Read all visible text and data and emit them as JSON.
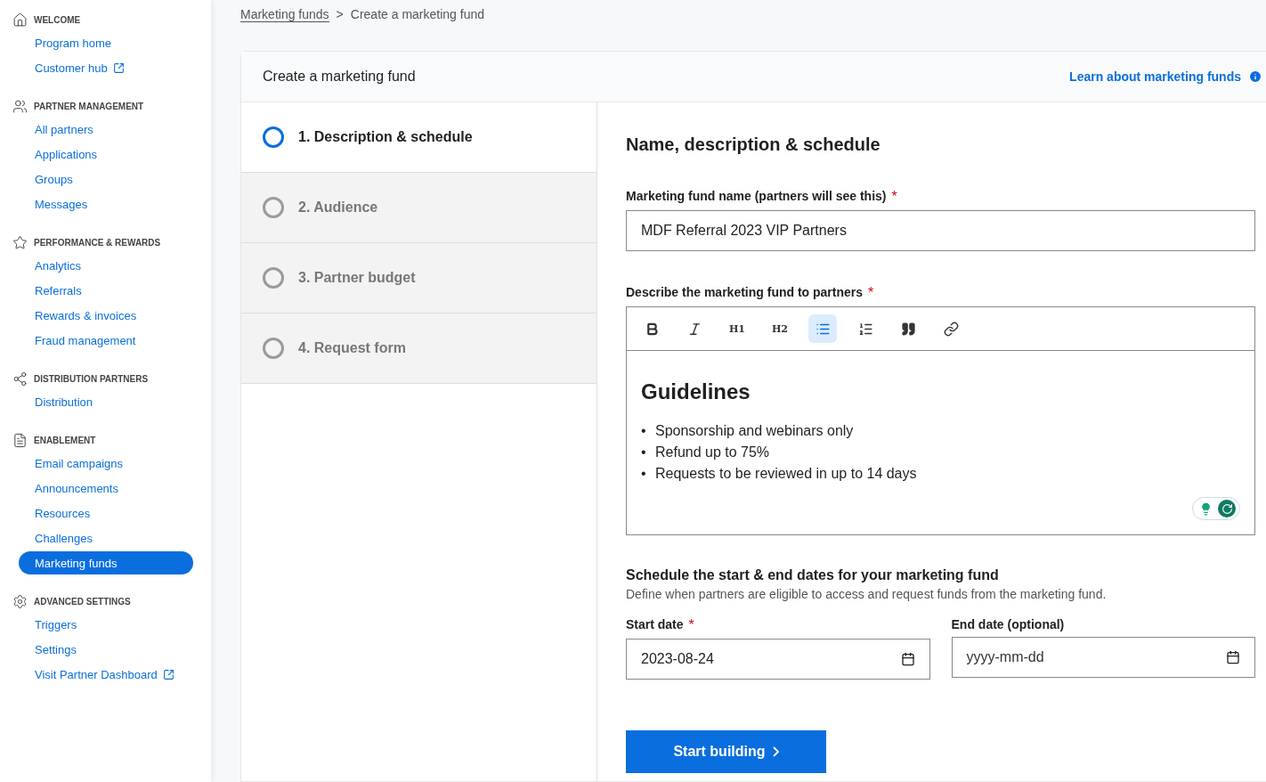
{
  "sidebar": {
    "sections": [
      {
        "title": "WELCOME",
        "items": [
          {
            "label": "Program home",
            "external": false,
            "selected": false
          },
          {
            "label": "Customer hub",
            "external": true,
            "selected": false
          }
        ]
      },
      {
        "title": "PARTNER MANAGEMENT",
        "items": [
          {
            "label": "All partners",
            "external": false,
            "selected": false
          },
          {
            "label": "Applications",
            "external": false,
            "selected": false
          },
          {
            "label": "Groups",
            "external": false,
            "selected": false
          },
          {
            "label": "Messages",
            "external": false,
            "selected": false
          }
        ]
      },
      {
        "title": "PERFORMANCE & REWARDS",
        "items": [
          {
            "label": "Analytics",
            "external": false,
            "selected": false
          },
          {
            "label": "Referrals",
            "external": false,
            "selected": false
          },
          {
            "label": "Rewards & invoices",
            "external": false,
            "selected": false
          },
          {
            "label": "Fraud management",
            "external": false,
            "selected": false
          }
        ]
      },
      {
        "title": "DISTRIBUTION PARTNERS",
        "items": [
          {
            "label": "Distribution",
            "external": false,
            "selected": false
          }
        ]
      },
      {
        "title": "ENABLEMENT",
        "items": [
          {
            "label": "Email campaigns",
            "external": false,
            "selected": false
          },
          {
            "label": "Announcements",
            "external": false,
            "selected": false
          },
          {
            "label": "Resources",
            "external": false,
            "selected": false
          },
          {
            "label": "Challenges",
            "external": false,
            "selected": false
          },
          {
            "label": "Marketing funds",
            "external": false,
            "selected": true
          }
        ]
      },
      {
        "title": "ADVANCED SETTINGS",
        "items": [
          {
            "label": "Triggers",
            "external": false,
            "selected": false
          },
          {
            "label": "Settings",
            "external": false,
            "selected": false
          },
          {
            "label": "Visit Partner Dashboard",
            "external": true,
            "selected": false
          }
        ]
      }
    ]
  },
  "breadcrumb": {
    "link": "Marketing funds",
    "separator": ">",
    "current": "Create a marketing fund"
  },
  "card": {
    "title": "Create a marketing fund",
    "help_link": "Learn about marketing funds"
  },
  "steps": [
    {
      "label": "1. Description & schedule",
      "selected": true
    },
    {
      "label": "2. Audience",
      "selected": false
    },
    {
      "label": "3. Partner budget",
      "selected": false
    },
    {
      "label": "4. Request form",
      "selected": false
    }
  ],
  "form": {
    "title": "Name, description & schedule",
    "name_field": {
      "label": "Marketing fund name (partners will see this)",
      "required_mark": "*",
      "value": "MDF Referral 2023 VIP Partners"
    },
    "description": {
      "label": "Describe the marketing fund to partners",
      "required_mark": "*",
      "toolbar": [
        {
          "kind": "bold",
          "active": false
        },
        {
          "kind": "italic",
          "active": false
        },
        {
          "kind": "heading",
          "label": "H1",
          "active": false
        },
        {
          "kind": "heading",
          "label": "H2",
          "active": false
        },
        {
          "kind": "bullets",
          "active": true
        },
        {
          "kind": "numbers",
          "active": false
        },
        {
          "kind": "quote",
          "active": false
        },
        {
          "kind": "link",
          "active": false
        }
      ],
      "heading": "Guidelines",
      "bullets": [
        {
          "marker": "•",
          "text": "Sponsorship and webinars only"
        },
        {
          "marker": "•",
          "text": "Refund up to 75%"
        },
        {
          "marker": "•",
          "text": "Requests to be reviewed in up to 14 days"
        }
      ]
    },
    "schedule": {
      "title": "Schedule the start & end dates for your marketing fund",
      "hint": "Define when partners are eligible to access and request funds from the marketing fund.",
      "dates": [
        {
          "label": "Start date",
          "required_mark": "*",
          "value": "2023-08-24"
        },
        {
          "label": "End date (optional)",
          "placeholder": "yyyy-mm-dd"
        }
      ]
    },
    "submit": "Start building"
  }
}
